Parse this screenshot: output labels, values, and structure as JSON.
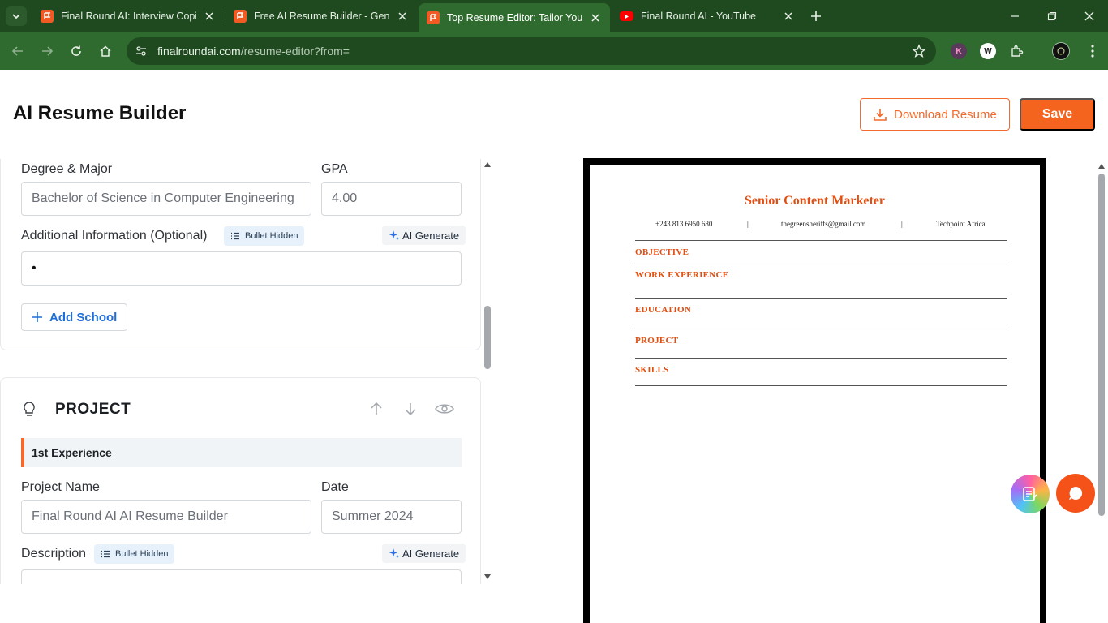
{
  "browser": {
    "tabs": [
      {
        "title": "Final Round AI: Interview Copilo",
        "favicon": "final-round-favicon",
        "active": false
      },
      {
        "title": "Free AI Resume Builder - Gener",
        "favicon": "final-round-favicon",
        "active": false
      },
      {
        "title": "Top Resume Editor: Tailor Your R",
        "favicon": "final-round-favicon",
        "active": true
      },
      {
        "title": "Final Round AI - YouTube",
        "favicon": "youtube-favicon",
        "active": false
      }
    ],
    "url_host": "finalroundai.com",
    "url_path": "/resume-editor?from=",
    "extensions": [
      "K",
      "W"
    ],
    "colors": {
      "tabbar": "#1f4a1f",
      "toolbar": "#2f6b2f"
    }
  },
  "header": {
    "title": "AI Resume Builder",
    "download_label": "Download Resume",
    "save_label": "Save",
    "accent": "#f5641e"
  },
  "education": {
    "degree_label": "Degree & Major",
    "degree_value": "Bachelor of Science in Computer Engineering",
    "gpa_label": "GPA",
    "gpa_value": "4.00",
    "additional_label": "Additional Information (Optional)",
    "bullet_pill": "Bullet Hidden",
    "ai_generate": "AI Generate",
    "additional_value": "•",
    "add_school": "Add School"
  },
  "project": {
    "section_title": "PROJECT",
    "experience_label": "1st Experience",
    "name_label": "Project Name",
    "name_value": "Final Round AI AI Resume Builder",
    "date_label": "Date",
    "date_value": "Summer 2024",
    "description_label": "Description",
    "bullet_pill": "Bullet Hidden",
    "ai_generate": "AI Generate"
  },
  "resume": {
    "name": "Senior Content Marketer",
    "phone": "+243 813 6950 680",
    "email": "thegreensheriffs@gmail.com",
    "company": "Techpoint Africa",
    "sections": [
      "OBJECTIVE",
      "WORK EXPERIENCE",
      "EDUCATION",
      "PROJECT",
      "SKILLS"
    ],
    "accent": "#e24e10"
  }
}
